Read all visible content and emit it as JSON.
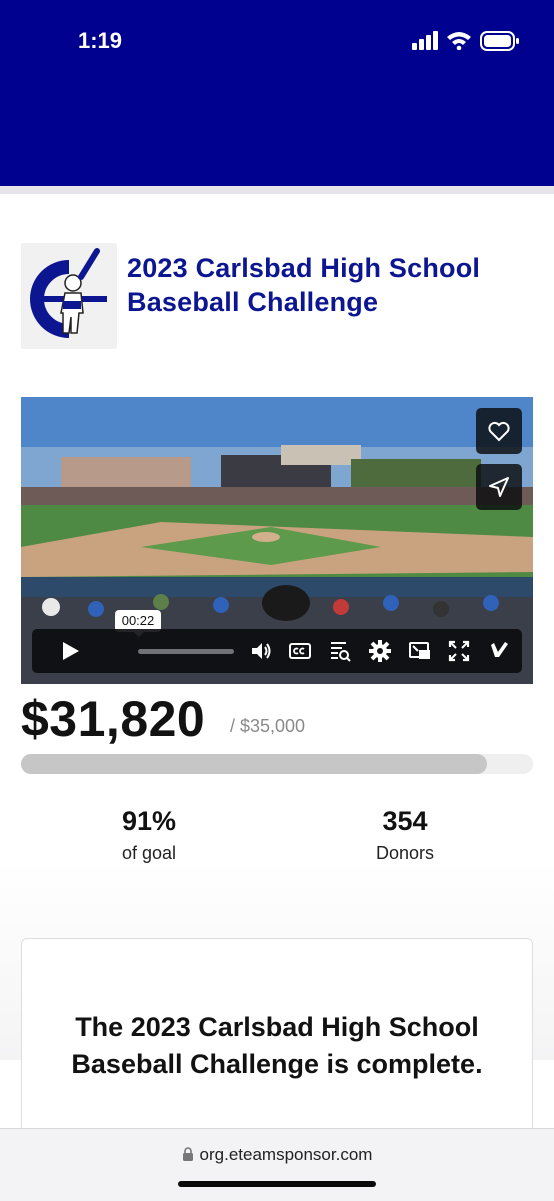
{
  "status_bar": {
    "time": "1:19"
  },
  "colors": {
    "header_blue": "#01018f",
    "title_blue": "#0c1690"
  },
  "campaign": {
    "title": "2023 Carlsbad High School Baseball Challenge",
    "raised": "$31,820",
    "goal": "/ $35,000",
    "progress_fraction": 0.91
  },
  "video": {
    "current_time": "00:22",
    "icons": [
      "heart-icon",
      "send-icon",
      "play-icon",
      "volume-icon",
      "cc-icon",
      "transcript-icon",
      "gear-icon",
      "pip-icon",
      "fullscreen-icon",
      "vimeo-icon"
    ]
  },
  "stats": [
    {
      "value": "91%",
      "label": "of goal"
    },
    {
      "value": "354",
      "label": "Donors"
    }
  ],
  "notice": {
    "text": "The 2023 Carlsbad High School Baseball Challenge is complete."
  },
  "browser": {
    "url": "org.eteamsponsor.com"
  }
}
